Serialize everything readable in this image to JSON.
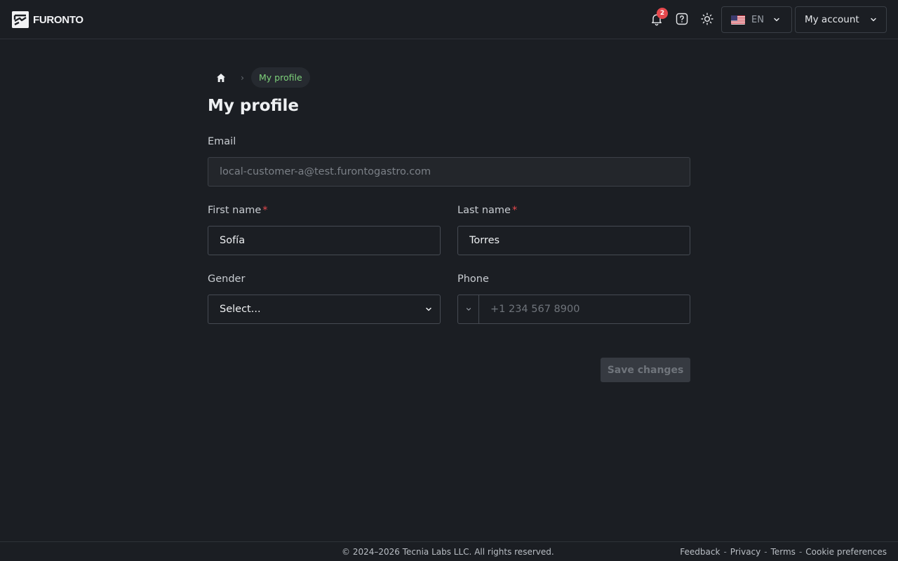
{
  "header": {
    "brand": "FURONTO",
    "notifications_count": "2",
    "language": {
      "code": "EN",
      "flag": "us-flag-icon"
    },
    "account_label": "My account"
  },
  "breadcrumb": {
    "home_icon": "home-icon",
    "current": "My profile"
  },
  "page": {
    "title": "My profile"
  },
  "form": {
    "email": {
      "label": "Email",
      "value": "local-customer-a@test.furontogastro.com"
    },
    "first_name": {
      "label": "First name",
      "required_mark": "*",
      "value": "Sofía"
    },
    "last_name": {
      "label": "Last name",
      "required_mark": "*",
      "value": "Torres"
    },
    "gender": {
      "label": "Gender",
      "selected": "Select..."
    },
    "phone": {
      "label": "Phone",
      "placeholder": "+1 234 567 8900",
      "value": ""
    },
    "save_label": "Save changes"
  },
  "footer": {
    "copyright": "© 2024–2026 Tecnia Labs LLC. All rights reserved.",
    "links": [
      "Feedback",
      "Privacy",
      "Terms",
      "Cookie preferences"
    ]
  },
  "colors": {
    "background": "#1b1e23",
    "accent_green": "#7ed27a",
    "required_red": "#e5484d"
  }
}
